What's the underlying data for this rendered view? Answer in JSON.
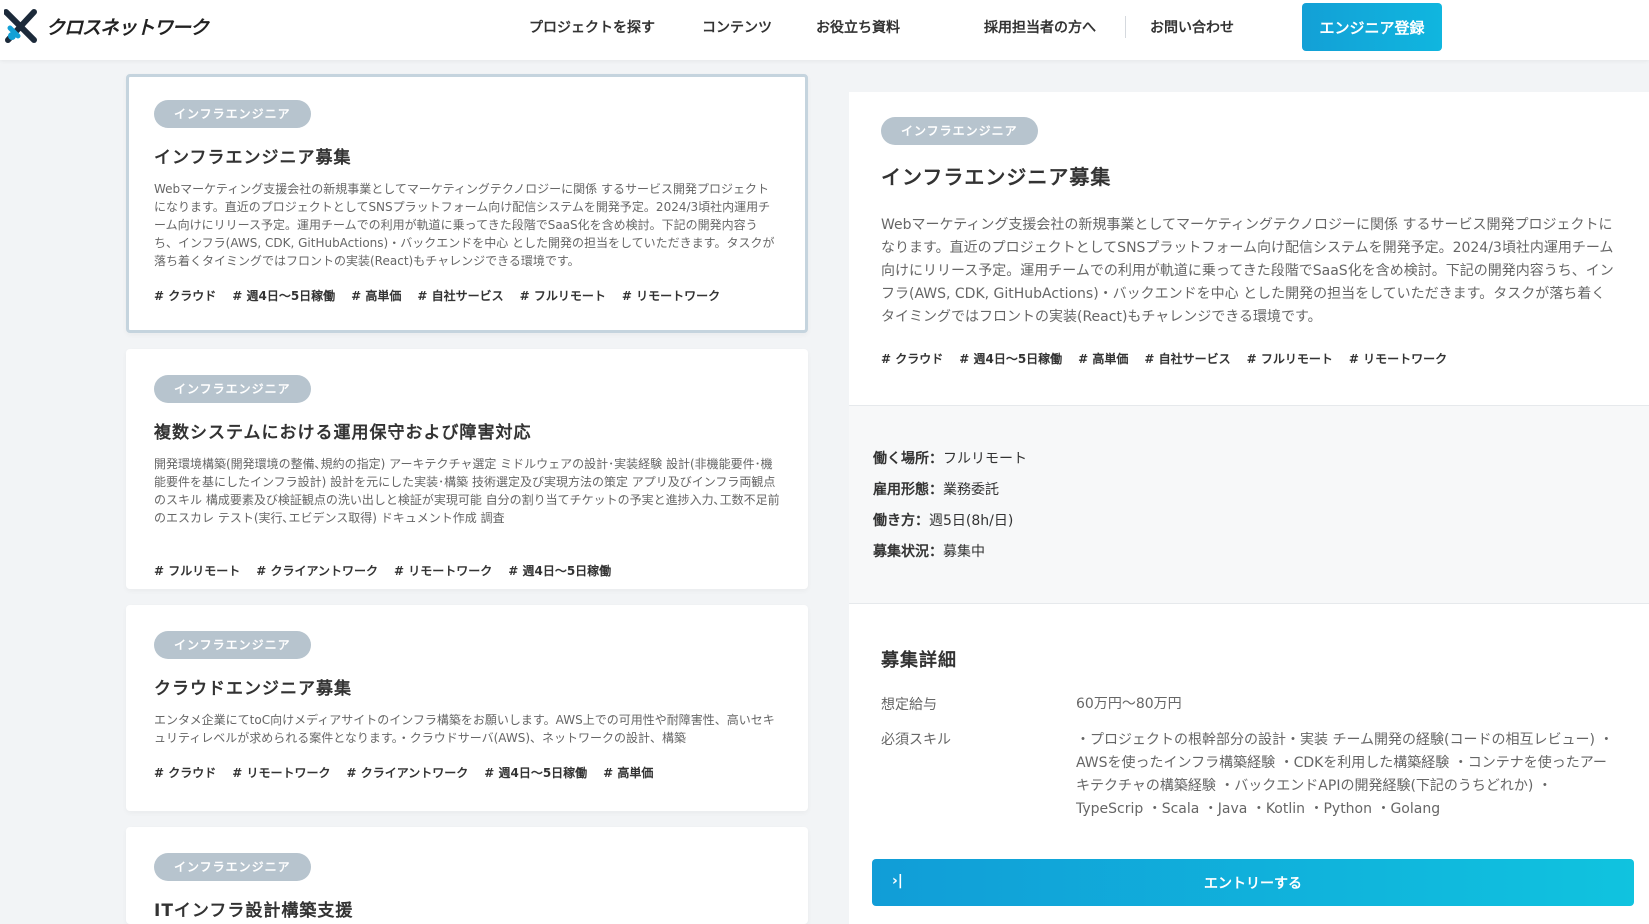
{
  "header": {
    "logo_text": "クロスネットワーク",
    "nav": [
      {
        "label": "プロジェクトを探す"
      },
      {
        "label": "コンテンツ"
      },
      {
        "label": "お役立ち資料"
      },
      {
        "label": "採用担当者の方へ"
      },
      {
        "label": "お問い合わせ"
      }
    ],
    "cta_label": "エンジニア登録"
  },
  "list": [
    {
      "badge": "インフラエンジニア",
      "title": "インフラエンジニア募集",
      "desc": "Webマーケティング支援会社の新規事業としてマーケティングテクノロジーに関係 するサービス開発プロジェクトになります。直近のプロジェクトとしてSNSプラットフォーム向け配信システムを開発予定。2024/3頃社内運用チーム向けにリリース予定。運用チームでの利用が軌道に乗ってきた段階でSaaS化を含め検討。下記の開発内容うち、インフラ(AWS, CDK, GitHubActions)・バックエンドを中心 とした開発の担当をしていただきます。タスクが落ち着くタイミングではフロントの実装(React)もチャレンジできる環境です。",
      "tags": [
        "# クラウド",
        "# 週4日～5日稼働",
        "# 高単価",
        "# 自社サービス",
        "# フルリモート",
        "# リモートワーク"
      ]
    },
    {
      "badge": "インフラエンジニア",
      "title": "複数システムにおける運用保守および障害対応",
      "desc": "開発環境構築(開発環境の整備､規約の指定) アーキテクチャ選定 ミドルウェアの設計･実装経験 設計(非機能要件･機能要件を基にしたインフラ設計) 設計を元にした実装･構築 技術選定及び実現方法の策定 アプリ及びインフラ両観点のスキル 構成要素及び検証観点の洗い出しと検証が実現可能 自分の割り当てチケットの予実と進捗入力､工数不足前のエスカレ テスト(実行､エビデンス取得) ドキュメント作成 調査",
      "tags": [
        "# フルリモート",
        "# クライアントワーク",
        "# リモートワーク",
        "# 週4日～5日稼働"
      ]
    },
    {
      "badge": "インフラエンジニア",
      "title": "クラウドエンジニア募集",
      "desc": "エンタメ企業にてtoC向けメディアサイトのインフラ構築をお願いします。AWS上での可用性や耐障害性、高いセキュリティレベルが求められる案件となります。・クラウドサーバ(AWS)、ネットワークの設計、構築",
      "tags": [
        "# クラウド",
        "# リモートワーク",
        "# クライアントワーク",
        "# 週4日～5日稼働",
        "# 高単価"
      ]
    },
    {
      "badge": "インフラエンジニア",
      "title": "ITインフラ設計構築支援",
      "desc": "",
      "tags": []
    }
  ],
  "detail": {
    "badge": "インフラエンジニア",
    "title": "インフラエンジニア募集",
    "desc": "Webマーケティング支援会社の新規事業としてマーケティングテクノロジーに関係 するサービス開発プロジェクトになります。直近のプロジェクトとしてSNSプラットフォーム向け配信システムを開発予定。2024/3頃社内運用チーム向けにリリース予定。運用チームでの利用が軌道に乗ってきた段階でSaaS化を含め検討。下記の開発内容うち、インフラ(AWS, CDK, GitHubActions)・バックエンドを中心 とした開発の担当をしていただきます。タスクが落ち着くタイミングではフロントの実装(React)もチャレンジできる環境です。",
    "tags": [
      "# クラウド",
      "# 週4日～5日稼働",
      "# 高単価",
      "# 自社サービス",
      "# フルリモート",
      "# リモートワーク"
    ],
    "info": [
      {
        "label": "働く場所：",
        "value": "フルリモート"
      },
      {
        "label": "雇用形態：",
        "value": "業務委託"
      },
      {
        "label": "働き方：",
        "value": "週5日(8h/日)"
      },
      {
        "label": "募集状況：",
        "value": "募集中"
      }
    ],
    "req_title": "募集詳細",
    "req": [
      {
        "key": "想定給与",
        "value": "60万円～80万円"
      },
      {
        "key": "必須スキル",
        "value": "・プロジェクトの根幹部分の設計・実装 チーム開発の経験(コードの相互レビュー) ・AWSを使ったインフラ構築経験 ・CDKを利用した構築経験 ・コンテナを使ったアーキテクチャの構築経験 ・バックエンドAPIの開発経験(下記のうちどれか) ・TypeScrip ・Scala ・Java ・Kotlin ・Python ・Golang"
      }
    ],
    "entry_label": "エントリーする",
    "entry_icon": "›|"
  }
}
